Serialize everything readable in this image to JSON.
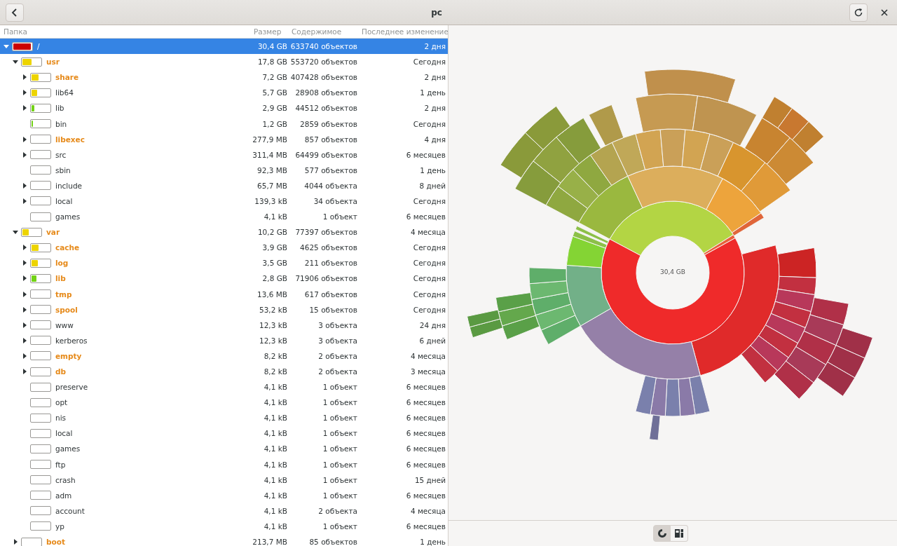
{
  "window": {
    "title": "pc"
  },
  "columns": [
    "Папка",
    "Размер",
    "Содержимое",
    "Последнее изменение"
  ],
  "tree": [
    {
      "name": "/",
      "size": "30,4 GB",
      "contents": "633740 объектов",
      "modified": "2 дня",
      "highlighted": false,
      "selected": true,
      "expanded": true,
      "level": 0.97,
      "color": "#cc0000",
      "children": [
        {
          "name": "usr",
          "size": "17,8 GB",
          "contents": "553720 объектов",
          "modified": "Сегодня",
          "highlighted": true,
          "selected": false,
          "expanded": true,
          "level": 0.5,
          "color": "#edd400",
          "children": [
            {
              "name": "share",
              "size": "7,2 GB",
              "contents": "407428 объектов",
              "modified": "2 дня",
              "highlighted": true,
              "selected": false,
              "expanded": false,
              "level": 0.38,
              "color": "#edd400"
            },
            {
              "name": "lib64",
              "size": "5,7 GB",
              "contents": "28908 объектов",
              "modified": "1 день",
              "highlighted": false,
              "selected": false,
              "expanded": false,
              "level": 0.32,
              "color": "#edd400"
            },
            {
              "name": "lib",
              "size": "2,9 GB",
              "contents": "44512 объектов",
              "modified": "2 дня",
              "highlighted": false,
              "selected": false,
              "expanded": false,
              "level": 0.16,
              "color": "#73d216"
            },
            {
              "name": "bin",
              "size": "1,2 GB",
              "contents": "2859 объектов",
              "modified": "Сегодня",
              "highlighted": false,
              "selected": false,
              "level": 0.07,
              "color": "#73d216"
            },
            {
              "name": "libexec",
              "size": "277,9 MB",
              "contents": "857 объектов",
              "modified": "4 дня",
              "highlighted": true,
              "selected": false,
              "expanded": false
            },
            {
              "name": "src",
              "size": "311,4 MB",
              "contents": "64499 объектов",
              "modified": "6 месяцев",
              "highlighted": false,
              "selected": false,
              "expanded": false
            },
            {
              "name": "sbin",
              "size": "92,3 MB",
              "contents": "577 объектов",
              "modified": "1 день",
              "highlighted": false,
              "selected": false
            },
            {
              "name": "include",
              "size": "65,7 MB",
              "contents": "4044 объекта",
              "modified": "8 дней",
              "highlighted": false,
              "selected": false,
              "expanded": false
            },
            {
              "name": "local",
              "size": "139,3 kB",
              "contents": "34 объекта",
              "modified": "Сегодня",
              "highlighted": false,
              "selected": false,
              "expanded": false
            },
            {
              "name": "games",
              "size": "4,1 kB",
              "contents": "1 объект",
              "modified": "6 месяцев",
              "highlighted": false,
              "selected": false
            }
          ]
        },
        {
          "name": "var",
          "size": "10,2 GB",
          "contents": "77397 объектов",
          "modified": "4 месяца",
          "highlighted": true,
          "selected": false,
          "expanded": true,
          "level": 0.34,
          "color": "#edd400",
          "children": [
            {
              "name": "cache",
              "size": "3,9 GB",
              "contents": "4625 объектов",
              "modified": "Сегодня",
              "highlighted": true,
              "selected": false,
              "expanded": false,
              "level": 0.38,
              "color": "#edd400"
            },
            {
              "name": "log",
              "size": "3,5 GB",
              "contents": "211 объектов",
              "modified": "Сегодня",
              "highlighted": true,
              "selected": false,
              "expanded": false,
              "level": 0.34,
              "color": "#edd400"
            },
            {
              "name": "lib",
              "size": "2,8 GB",
              "contents": "71906 объектов",
              "modified": "Сегодня",
              "highlighted": true,
              "selected": false,
              "expanded": false,
              "level": 0.27,
              "color": "#73d216"
            },
            {
              "name": "tmp",
              "size": "13,6 MB",
              "contents": "617 объектов",
              "modified": "Сегодня",
              "highlighted": true,
              "selected": false,
              "expanded": false
            },
            {
              "name": "spool",
              "size": "53,2 kB",
              "contents": "15 объектов",
              "modified": "Сегодня",
              "highlighted": true,
              "selected": false,
              "expanded": false
            },
            {
              "name": "www",
              "size": "12,3 kB",
              "contents": "3 объекта",
              "modified": "24 дня",
              "highlighted": false,
              "selected": false,
              "expanded": false
            },
            {
              "name": "kerberos",
              "size": "12,3 kB",
              "contents": "3 объекта",
              "modified": "6 дней",
              "highlighted": false,
              "selected": false,
              "expanded": false
            },
            {
              "name": "empty",
              "size": "8,2 kB",
              "contents": "2 объекта",
              "modified": "4 месяца",
              "highlighted": true,
              "selected": false,
              "expanded": false
            },
            {
              "name": "db",
              "size": "8,2 kB",
              "contents": "2 объекта",
              "modified": "3 месяца",
              "highlighted": true,
              "selected": false,
              "expanded": false
            },
            {
              "name": "preserve",
              "size": "4,1 kB",
              "contents": "1 объект",
              "modified": "6 месяцев",
              "highlighted": false,
              "selected": false
            },
            {
              "name": "opt",
              "size": "4,1 kB",
              "contents": "1 объект",
              "modified": "6 месяцев",
              "highlighted": false,
              "selected": false
            },
            {
              "name": "nis",
              "size": "4,1 kB",
              "contents": "1 объект",
              "modified": "6 месяцев",
              "highlighted": false,
              "selected": false
            },
            {
              "name": "local",
              "size": "4,1 kB",
              "contents": "1 объект",
              "modified": "6 месяцев",
              "highlighted": false,
              "selected": false
            },
            {
              "name": "games",
              "size": "4,1 kB",
              "contents": "1 объект",
              "modified": "6 месяцев",
              "highlighted": false,
              "selected": false
            },
            {
              "name": "ftp",
              "size": "4,1 kB",
              "contents": "1 объект",
              "modified": "6 месяцев",
              "highlighted": false,
              "selected": false
            },
            {
              "name": "crash",
              "size": "4,1 kB",
              "contents": "1 объект",
              "modified": "15 дней",
              "highlighted": false,
              "selected": false
            },
            {
              "name": "adm",
              "size": "4,1 kB",
              "contents": "1 объект",
              "modified": "6 месяцев",
              "highlighted": false,
              "selected": false
            },
            {
              "name": "account",
              "size": "4,1 kB",
              "contents": "2 объекта",
              "modified": "4 месяца",
              "highlighted": false,
              "selected": false
            },
            {
              "name": "yp",
              "size": "4,1 kB",
              "contents": "1 объект",
              "modified": "6 месяцев",
              "highlighted": false,
              "selected": false
            }
          ]
        },
        {
          "name": "boot",
          "size": "213,7 MB",
          "contents": "85 объектов",
          "modified": "1 день",
          "highlighted": true,
          "selected": false,
          "expanded": false
        }
      ]
    }
  ],
  "chart_center_label": "30,4 GB",
  "view_buttons": [
    {
      "kind": "rings",
      "selected": true
    },
    {
      "kind": "treemap",
      "selected": false
    }
  ]
}
